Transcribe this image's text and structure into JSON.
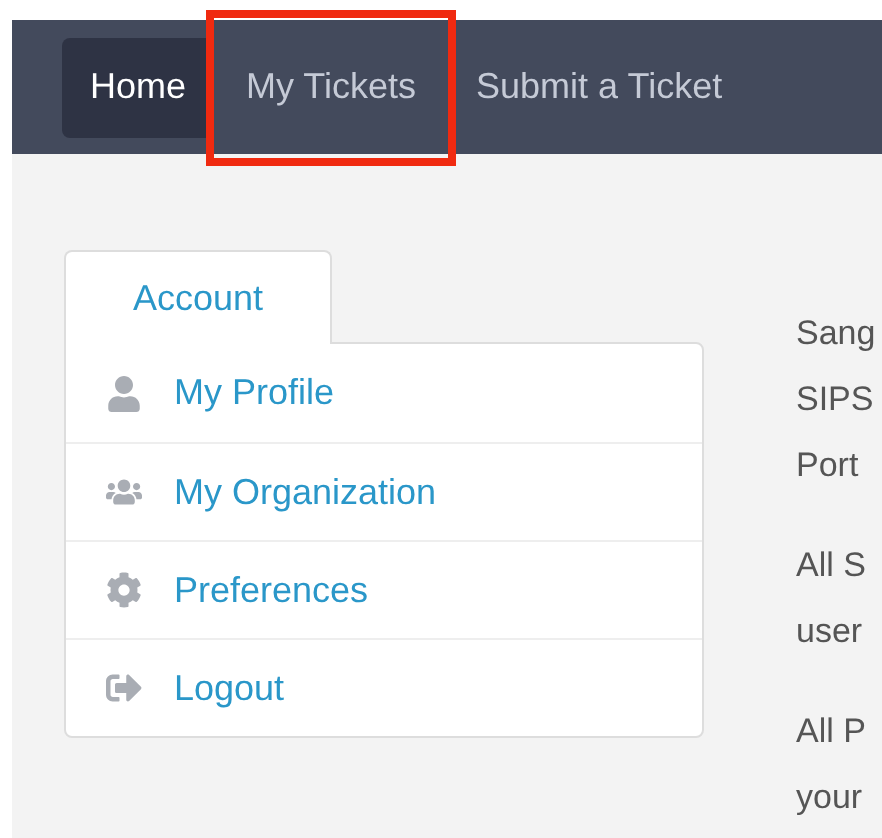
{
  "nav": {
    "items": [
      {
        "label": "Home",
        "selected": true,
        "highlighted": false
      },
      {
        "label": "My Tickets",
        "selected": false,
        "highlighted": true
      },
      {
        "label": "Submit a Ticket",
        "selected": false,
        "highlighted": false
      }
    ]
  },
  "account_panel": {
    "tab": "Account",
    "items": [
      {
        "kind": "profile",
        "label": "My Profile"
      },
      {
        "kind": "organization",
        "label": "My Organization"
      },
      {
        "kind": "preferences",
        "label": "Preferences"
      },
      {
        "kind": "logout",
        "label": "Logout"
      }
    ]
  },
  "content": {
    "paragraphs": [
      [
        "Sang",
        "SIPS",
        "Port"
      ],
      [
        "All S",
        "user"
      ],
      [
        "All P",
        "your"
      ]
    ]
  }
}
